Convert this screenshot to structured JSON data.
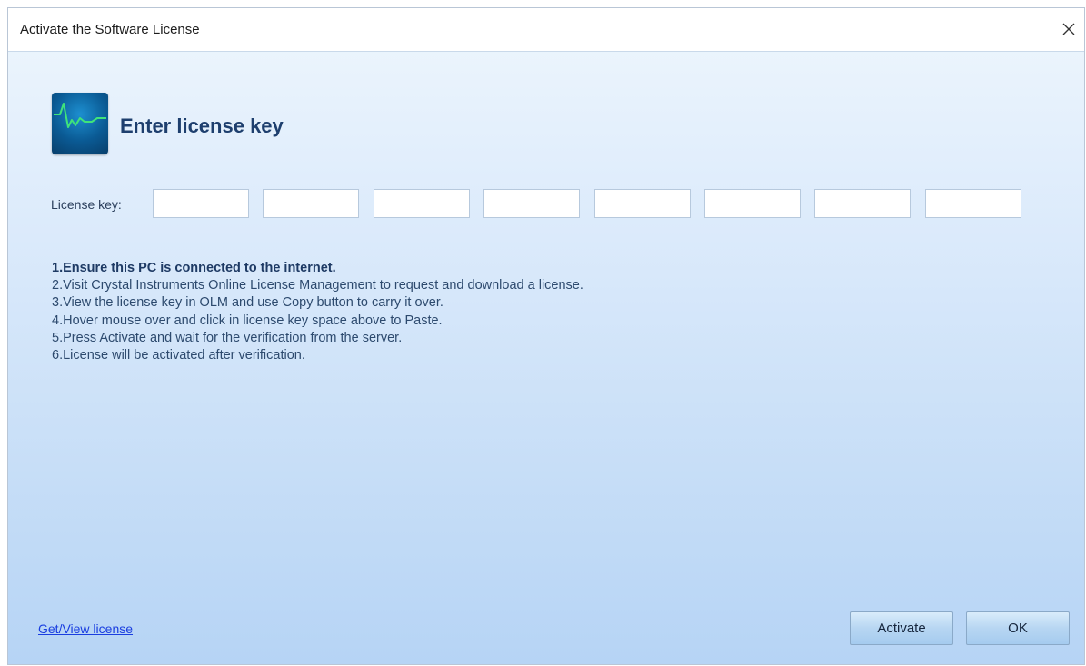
{
  "window": {
    "title": "Activate the Software License",
    "close_glyph": "✕"
  },
  "header": {
    "icon": "waveform-icon",
    "title": "Enter license key"
  },
  "license": {
    "label": "License key:",
    "fields": [
      "",
      "",
      "",
      "",
      "",
      "",
      "",
      ""
    ]
  },
  "instructions": [
    "1.Ensure this PC is connected to the internet.",
    "2.Visit Crystal Instruments Online License Management to request and download a license.",
    "3.View the license key in OLM and use Copy button to carry it over.",
    "4.Hover mouse over and click in license key space above to Paste.",
    "5.Press Activate and wait for the verification from the server.",
    "6.License will be activated after verification."
  ],
  "footer": {
    "link_label": "Get/View license",
    "activate_label": "Activate",
    "ok_label": "OK"
  },
  "colors": {
    "header_title": "#1e3f6e",
    "link": "#1a3ee0",
    "waveform": "#3fe37a"
  }
}
